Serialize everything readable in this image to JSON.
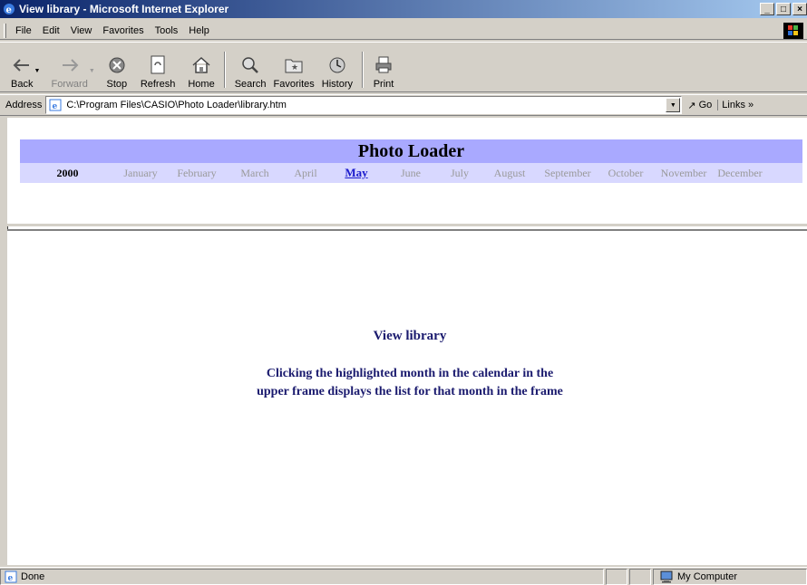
{
  "window": {
    "title": "View library - Microsoft Internet Explorer",
    "minimize": "_",
    "maximize": "□",
    "close": "×"
  },
  "menu": {
    "items": [
      "File",
      "Edit",
      "View",
      "Favorites",
      "Tools",
      "Help"
    ]
  },
  "toolbar": {
    "back": "Back",
    "forward": "Forward",
    "stop": "Stop",
    "refresh": "Refresh",
    "home": "Home",
    "search": "Search",
    "favorites": "Favorites",
    "history": "History",
    "print": "Print"
  },
  "address": {
    "label": "Address",
    "value": "C:\\Program Files\\CASIO\\Photo Loader\\library.htm",
    "go": "Go",
    "links": "Links"
  },
  "page": {
    "header": "Photo Loader",
    "year": "2000",
    "months": [
      "January",
      "February",
      "March",
      "April",
      "May",
      "June",
      "July",
      "August",
      "September",
      "October",
      "November",
      "December"
    ],
    "active_month": "May",
    "view_title": "View library",
    "view_text_line1": "Clicking the highlighted month in the calendar in the",
    "view_text_line2": "upper frame displays the list for that month in the frame"
  },
  "status": {
    "text": "Done",
    "zone": "My Computer"
  },
  "colors": {
    "title_gradient_start": "#0a246a",
    "header_band": "#a9a9ff",
    "months_band": "#d8d8ff",
    "active_month": "#1a1acc",
    "inactive_month": "#999999",
    "body_text": "#1a1a6e"
  }
}
